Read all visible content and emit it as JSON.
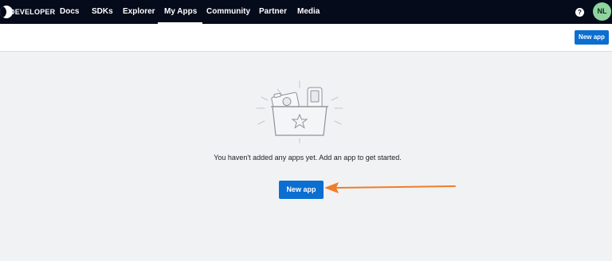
{
  "topnav": {
    "brand": "DEVELOPER",
    "items": [
      {
        "label": "Docs",
        "active": false
      },
      {
        "label": "SDKs",
        "active": false
      },
      {
        "label": "Explorer",
        "active": false
      },
      {
        "label": "My Apps",
        "active": true
      },
      {
        "label": "Community",
        "active": false
      },
      {
        "label": "Partner",
        "active": false
      },
      {
        "label": "Media",
        "active": false
      }
    ],
    "help_icon": "help-circle-icon",
    "avatar_initials": "NL"
  },
  "header": {
    "new_app_label": "New app"
  },
  "main": {
    "illustration_icon": "empty-box-star-icon",
    "empty_message": "You haven't added any apps yet. Add an app to get started.",
    "new_app_label": "New app"
  },
  "annotation": {
    "arrow_icon": "arrow-left-icon",
    "color": "#f07d2a"
  },
  "colors": {
    "nav_bg": "#050b1b",
    "primary": "#0b6ed1",
    "avatar_bg": "#8fd39f",
    "page_bg": "#f1f2f4"
  }
}
